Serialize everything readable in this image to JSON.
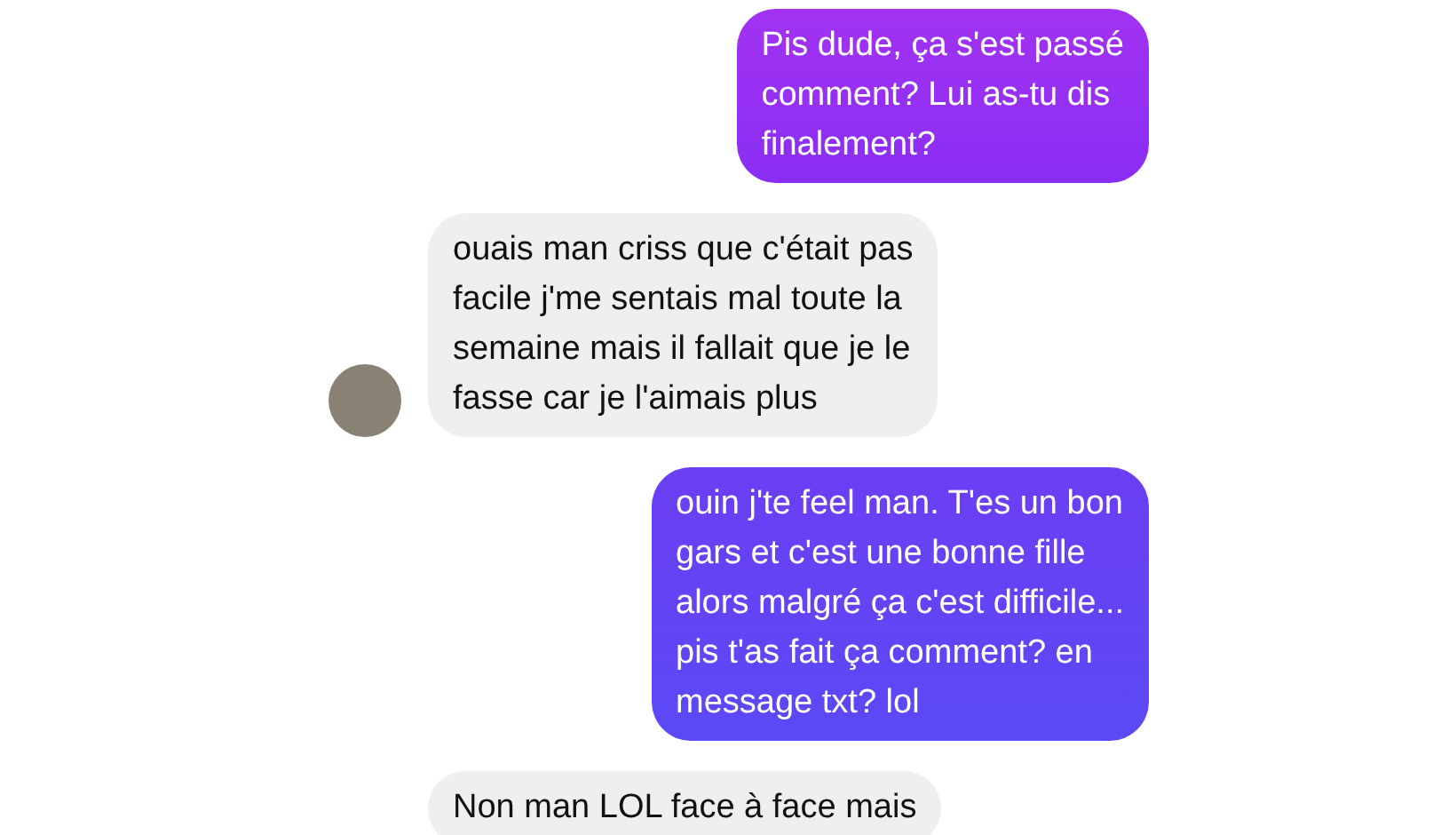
{
  "messages": [
    {
      "kind": "sent",
      "text": "Pis dude, ça s'est passé\ncomment? Lui as-tu dis\nfinalement?"
    },
    {
      "kind": "received",
      "text": "ouais man criss que c'était pas\nfacile j'me sentais mal toute la\nsemaine mais il fallait que je le\nfasse car je l'aimais plus",
      "avatar": true
    },
    {
      "kind": "sent",
      "text": "ouin j'te feel man. T'es un bon\ngars et c'est une bonne fille\nalors malgré ça c'est difficile...\npis t'as fait ça comment? en\nmessage txt? lol"
    },
    {
      "kind": "received",
      "text": "Non man LOL face à face mais",
      "avatar": false
    }
  ]
}
